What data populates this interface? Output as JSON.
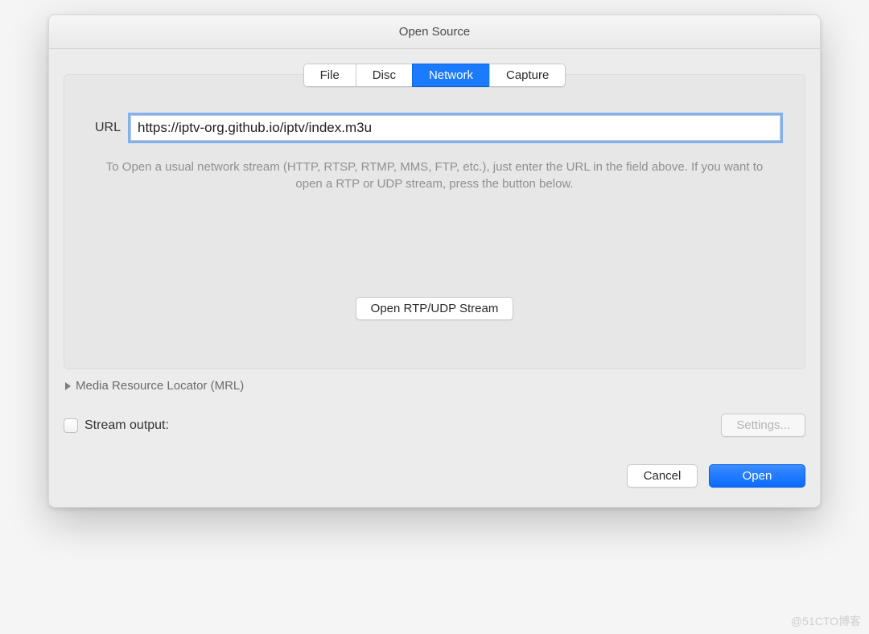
{
  "window": {
    "title": "Open Source"
  },
  "tabs": [
    {
      "label": "File",
      "active": false
    },
    {
      "label": "Disc",
      "active": false
    },
    {
      "label": "Network",
      "active": true
    },
    {
      "label": "Capture",
      "active": false
    }
  ],
  "network": {
    "url_label": "URL",
    "url_value": "https://iptv-org.github.io/iptv/index.m3u",
    "help_text": "To Open a usual network stream (HTTP, RTSP, RTMP, MMS, FTP, etc.), just enter the URL in the field above. If you want to open a RTP or UDP stream, press the button below.",
    "rtp_button": "Open RTP/UDP Stream"
  },
  "mrl": {
    "label": "Media Resource Locator (MRL)"
  },
  "stream": {
    "checkbox_label": "Stream output:",
    "checked": false,
    "settings_button": "Settings..."
  },
  "actions": {
    "cancel": "Cancel",
    "open": "Open"
  },
  "watermark": "@51CTO博客"
}
